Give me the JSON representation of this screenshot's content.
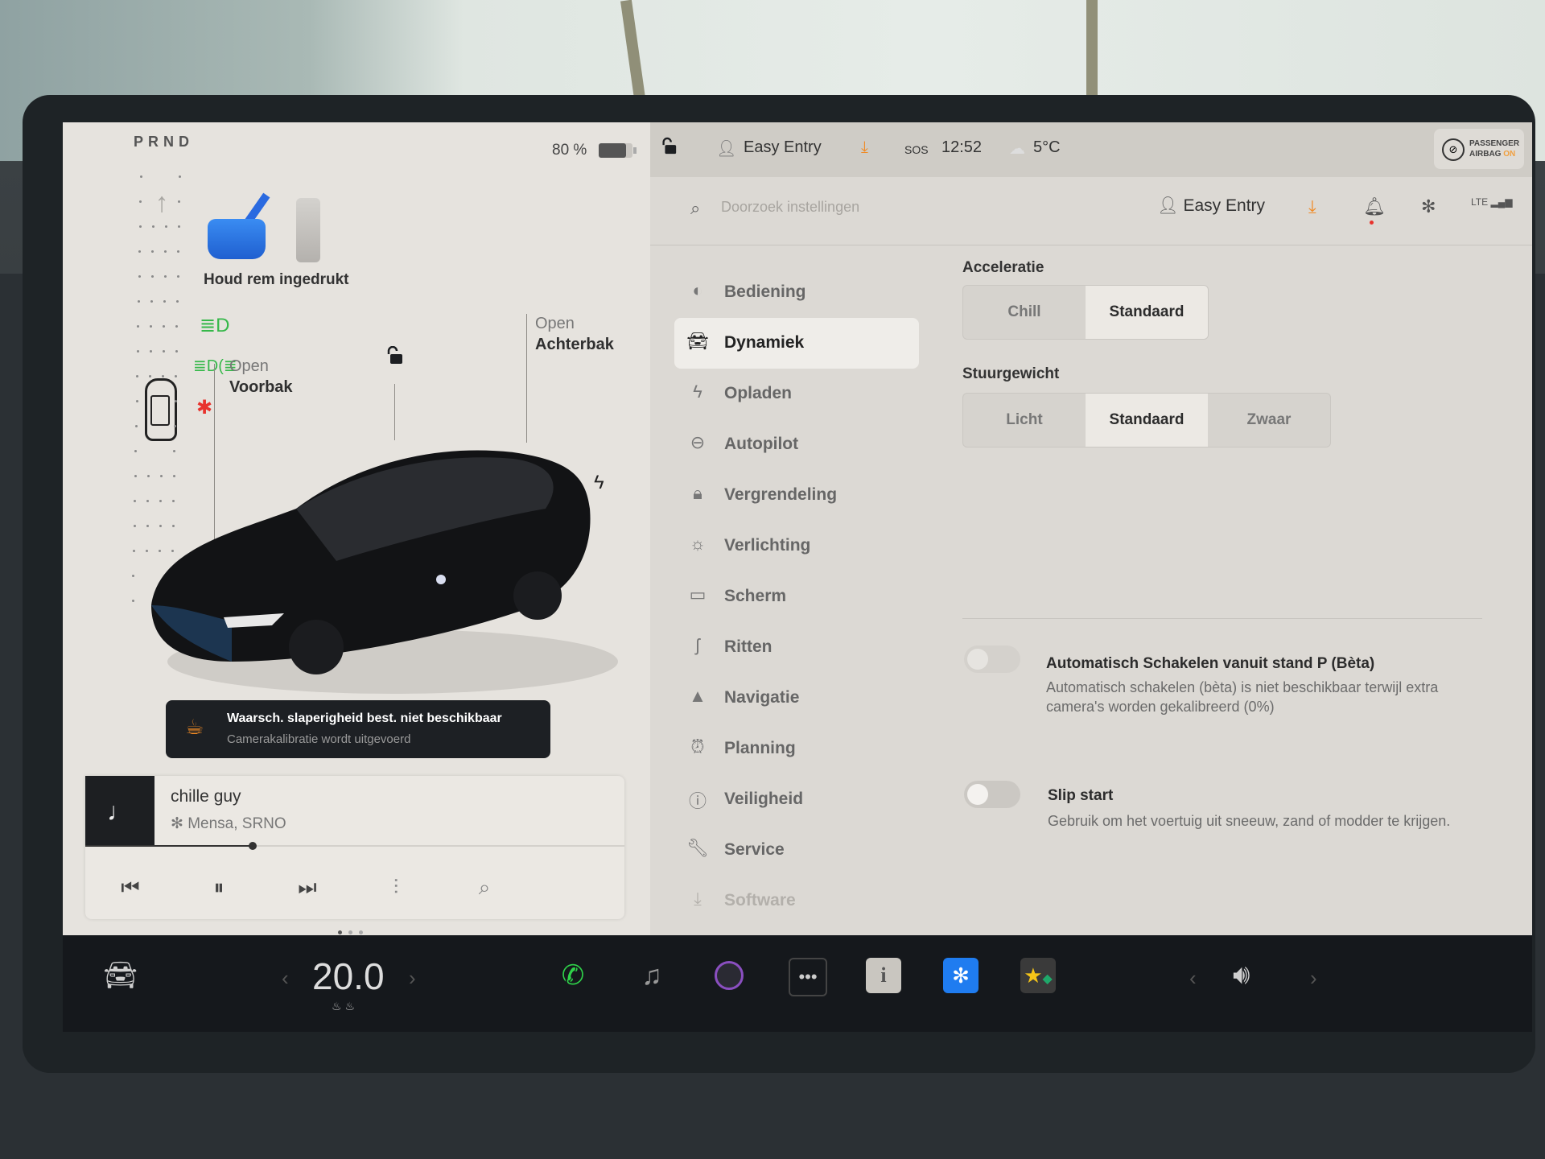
{
  "gear": "PRND",
  "battery": {
    "percent_label": "80 %",
    "level": 0.8
  },
  "brake_prompt": "Houd rem ingedrukt",
  "frunk": {
    "state": "Open",
    "label": "Voorbak"
  },
  "trunk": {
    "state": "Open",
    "label": "Achterbak"
  },
  "indicators": {
    "low_beam": "low-beam-icon",
    "fog": "fog-light-icon",
    "seatbelt": "seatbelt-warning-icon"
  },
  "colors": {
    "indicator_green": "#36b84a",
    "warning_red": "#e8332d",
    "accent_orange": "#f08a24",
    "bluetooth_blue": "#1f7cf0"
  },
  "toast": {
    "title": "Waarsch. slaperigheid best. niet beschikbaar",
    "subtitle": "Camerakalibratie wordt uitgevoerd"
  },
  "media": {
    "song": "chille guy",
    "artist": "Mensa, SRNO",
    "source_icon": "bluetooth-icon",
    "progress": 0.31,
    "album_glyph": "♩"
  },
  "status_bar": {
    "profile": "Easy Entry",
    "sos": "SOS",
    "time": "12:52",
    "temperature": "5°C",
    "airbag_line1": "PASSENGER",
    "airbag_line2": "AIRBAG",
    "airbag_state": "ON"
  },
  "settings_header": {
    "search_placeholder": "Doorzoek instellingen",
    "profile": "Easy Entry",
    "network": "LTE"
  },
  "menu": [
    {
      "label": "Bediening",
      "icon": "toggle-icon"
    },
    {
      "label": "Dynamiek",
      "icon": "car-icon",
      "active": true
    },
    {
      "label": "Opladen",
      "icon": "bolt-icon"
    },
    {
      "label": "Autopilot",
      "icon": "steering-wheel-icon"
    },
    {
      "label": "Vergrendeling",
      "icon": "lock-icon"
    },
    {
      "label": "Verlichting",
      "icon": "light-icon"
    },
    {
      "label": "Scherm",
      "icon": "display-icon"
    },
    {
      "label": "Ritten",
      "icon": "trips-icon"
    },
    {
      "label": "Navigatie",
      "icon": "navigation-icon"
    },
    {
      "label": "Planning",
      "icon": "alarm-icon"
    },
    {
      "label": "Veiligheid",
      "icon": "alert-icon"
    },
    {
      "label": "Service",
      "icon": "wrench-icon"
    },
    {
      "label": "Software",
      "icon": "download-icon"
    }
  ],
  "dynamics": {
    "acceleration": {
      "title": "Acceleratie",
      "options": [
        "Chill",
        "Standaard"
      ],
      "selected": "Standaard"
    },
    "steering": {
      "title": "Stuurgewicht",
      "options": [
        "Licht",
        "Standaard",
        "Zwaar"
      ],
      "selected": "Standaard"
    },
    "auto_shift": {
      "title": "Automatisch Schakelen vanuit stand P (Bèta)",
      "description": "Automatisch schakelen (bèta) is niet beschikbaar terwijl extra camera's worden gekalibreerd (0%)",
      "enabled": false,
      "disabled": true
    },
    "slip_start": {
      "title": "Slip start",
      "description": "Gebruik om het voertuig uit sneeuw, zand of modder te krijgen.",
      "enabled": false
    }
  },
  "bottom_bar": {
    "cabin_temp": "20.0",
    "apps": [
      "phone-icon",
      "music-icon",
      "camera-icon",
      "more-icon",
      "manual-icon",
      "bluetooth-icon",
      "games-icon"
    ]
  }
}
